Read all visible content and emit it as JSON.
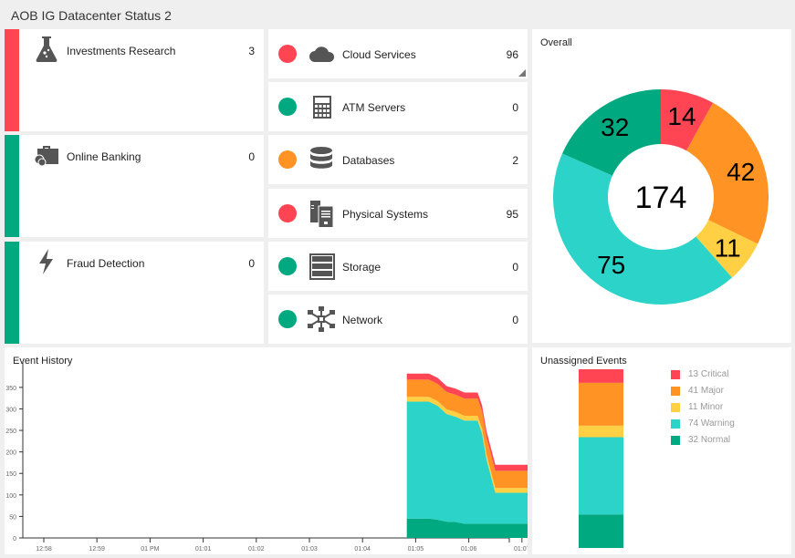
{
  "header": {
    "title": "AOB IG Datacenter Status 2"
  },
  "colors": {
    "critical": "#ff4554",
    "major": "#ff9323",
    "minor": "#ffd043",
    "warning": "#2bd3c8",
    "normal": "#00a980",
    "icon": "#555555"
  },
  "services": [
    {
      "label": "Investments Research",
      "count": "3",
      "status": "critical",
      "icon": "flask-icon"
    },
    {
      "label": "Online Banking",
      "count": "0",
      "status": "normal",
      "icon": "briefcase-icon"
    },
    {
      "label": "Fraud Detection",
      "count": "0",
      "status": "normal",
      "icon": "lightning-icon"
    }
  ],
  "cis": [
    {
      "label": "Cloud Services",
      "count": "96",
      "status": "critical",
      "icon": "cloud-icon"
    },
    {
      "label": "ATM Servers",
      "count": "0",
      "status": "normal",
      "icon": "calculator-icon"
    },
    {
      "label": "Databases",
      "count": "2",
      "status": "major",
      "icon": "database-icon"
    },
    {
      "label": "Physical Systems",
      "count": "95",
      "status": "critical",
      "icon": "server-icon"
    },
    {
      "label": "Storage",
      "count": "0",
      "status": "normal",
      "icon": "storage-icon"
    },
    {
      "label": "Network",
      "count": "0",
      "status": "normal",
      "icon": "network-icon"
    }
  ],
  "overall": {
    "title": "Overall",
    "total": "174"
  },
  "event_history": {
    "title": "Event History"
  },
  "unassigned": {
    "title": "Unassigned Events",
    "legend": [
      {
        "text": "13  Critical",
        "key": "critical"
      },
      {
        "text": "41  Major",
        "key": "major"
      },
      {
        "text": "11  Minor",
        "key": "minor"
      },
      {
        "text": "74  Warning",
        "key": "warning"
      },
      {
        "text": "32  Normal",
        "key": "normal"
      }
    ]
  },
  "chart_data": [
    {
      "type": "pie",
      "title": "Overall",
      "center_label": "174",
      "categories": [
        "Critical",
        "Major",
        "Minor",
        "Warning",
        "Normal"
      ],
      "values": [
        14,
        42,
        11,
        75,
        32
      ]
    },
    {
      "type": "area",
      "title": "Event History",
      "stacked": true,
      "x": [
        "01:04:50",
        "01:05:15",
        "01:05:25",
        "01:05:35",
        "01:05:45",
        "01:05:55",
        "01:06:10",
        "01:06:15",
        "01:06:20",
        "01:06:30",
        "01:07:10"
      ],
      "xticks": [
        "12:58",
        "12:59",
        "01 PM",
        "01:01",
        "01:02",
        "01:03",
        "01:04",
        "01:05",
        "01:06",
        "01:07"
      ],
      "yticks": [
        0,
        50,
        100,
        150,
        200,
        250,
        300,
        350
      ],
      "ylim": [
        0,
        390
      ],
      "series": [
        {
          "name": "Normal",
          "values": [
            45,
            45,
            42,
            38,
            37,
            33,
            33,
            33,
            33,
            33,
            33
          ]
        },
        {
          "name": "Warning",
          "values": [
            272,
            272,
            265,
            250,
            245,
            240,
            240,
            210,
            150,
            72,
            72
          ]
        },
        {
          "name": "Minor",
          "values": [
            11,
            11,
            11,
            11,
            11,
            11,
            11,
            11,
            11,
            11,
            11
          ]
        },
        {
          "name": "Major",
          "values": [
            40,
            40,
            40,
            40,
            40,
            40,
            40,
            40,
            40,
            40,
            40
          ]
        },
        {
          "name": "Critical",
          "values": [
            14,
            14,
            14,
            14,
            14,
            14,
            14,
            14,
            14,
            14,
            14
          ]
        }
      ]
    },
    {
      "type": "bar",
      "title": "Unassigned Events",
      "stacked": true,
      "categories": [
        "Critical",
        "Major",
        "Minor",
        "Warning",
        "Normal"
      ],
      "values": [
        13,
        41,
        11,
        74,
        32
      ]
    }
  ]
}
